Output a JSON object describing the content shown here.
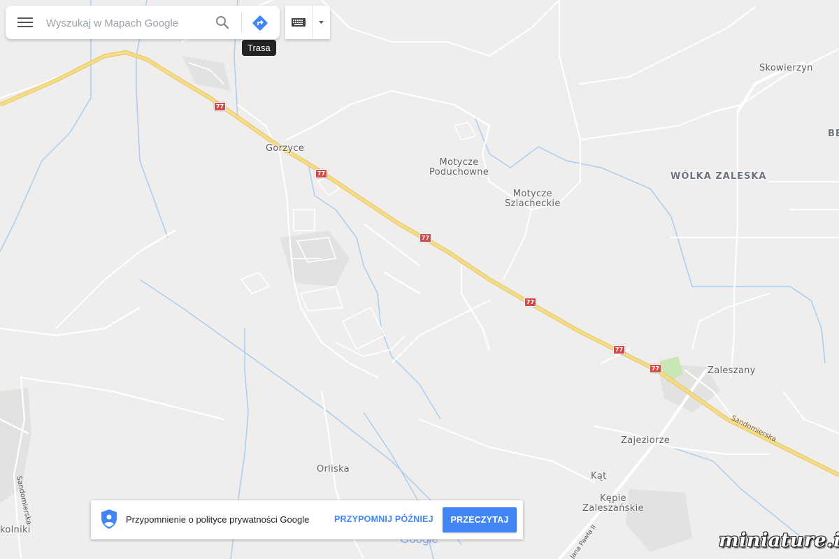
{
  "search": {
    "placeholder": "Wyszukaj w Mapach Google"
  },
  "tooltip": "Trasa",
  "places": {
    "skowierzyn": "Skowierzyn",
    "be": "BE",
    "gorzyce": "Gorzyce",
    "motycze_poduchowne": "Motycze\nPoduchowne",
    "wolka_zaleska": "WÓLKA ZALESKA",
    "motycze_szlacheckie": "Motycze\nSzlacheckie",
    "zaleszany": "Zaleszany",
    "zajeziorze": "Zajeziorze",
    "orliska": "Orliska",
    "kat": "Kąt",
    "kepie_zaleszanskie": "Kępie\nZaleszańskie",
    "kolniki": "kolniki",
    "sandomierska_road": "Sandomierska",
    "sandomierska_left": "Sandomierska",
    "jana_pawla": "Jana Pawła II"
  },
  "route_number": "77",
  "banner": {
    "text": "Przypomnienie o polityce prywatności Google",
    "remind_later": "PRZYPOMNIJ PÓŹNIEJ",
    "read": "PRZECZYTAJ"
  },
  "google_logo": "Google",
  "watermark": "miniature.io",
  "icons": {
    "menu": "menu-icon",
    "search": "search-icon",
    "directions": "directions-icon",
    "keyboard": "keyboard-icon",
    "dropdown": "dropdown-arrow-icon",
    "shield": "privacy-shield-icon"
  },
  "colors": {
    "map_bg": "#efeeec",
    "highway": "#f6dc84",
    "river": "#a9cdf3",
    "road": "#ffffff",
    "accent": "#4285f4",
    "shield_red": "#d14b4b"
  }
}
